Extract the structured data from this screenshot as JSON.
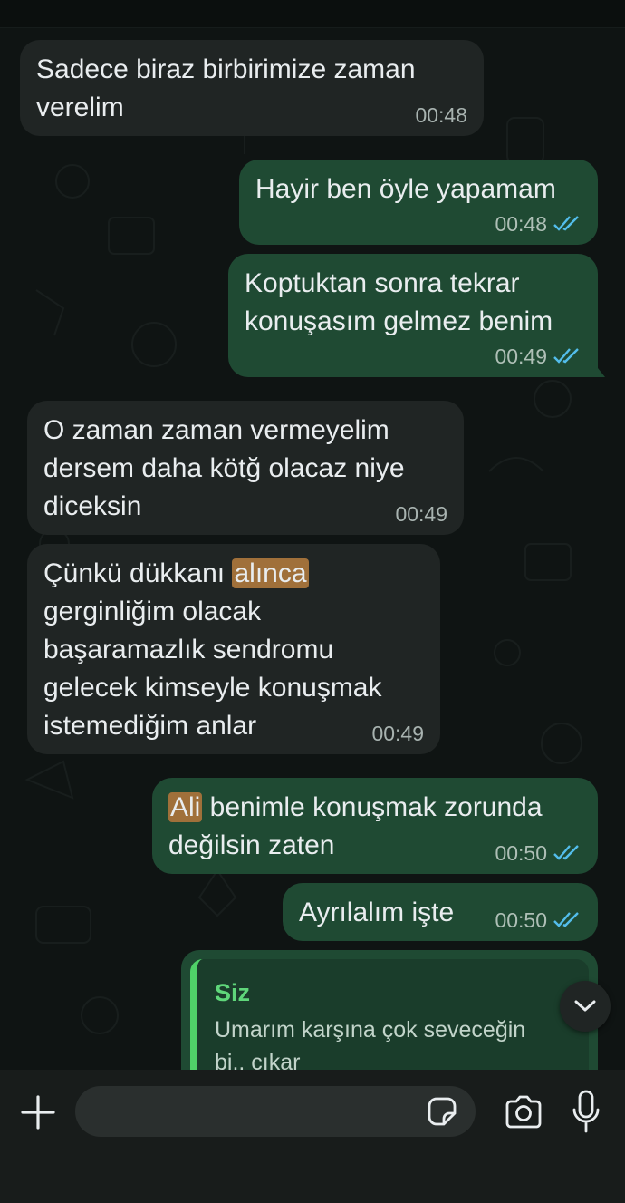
{
  "messages": [
    {
      "dir": "in",
      "text": "Sadece biraz birbirimize zaman\nverelim",
      "time": "00:48"
    },
    {
      "dir": "out",
      "text": "Hayir ben öyle yapamam",
      "time": "00:48",
      "read": true
    },
    {
      "dir": "out",
      "text": "Koptuktan sonra tekrar\nkonuşasım gelmez benim",
      "time": "00:49",
      "read": true
    },
    {
      "dir": "in",
      "text": "O zaman zaman vermeyelim\ndersem daha kötğ olacaz niye\ndiceksin",
      "time": "00:49"
    },
    {
      "dir": "in",
      "pre": "Çünkü dükkanı ",
      "highlight": "alınca",
      "post": "\ngerginliğim  olacak\nbaşaramazlık sendromu\ngelecek kimseyle konuşmak\nistemediğim anlar",
      "time": "00:49"
    },
    {
      "dir": "out",
      "highlight": "Ali",
      "post": " benimle konuşmak zorunda\ndeğilsin zaten",
      "time": "00:50",
      "read": true
    },
    {
      "dir": "out",
      "text": "Ayrılalım işte",
      "time": "00:50",
      "read": true
    }
  ],
  "reply_quote": {
    "author": "Siz",
    "text": "Umarım karşına çok seveceğin bi.. çıkar"
  },
  "composer": {
    "placeholder": ""
  },
  "icons": {
    "plus": "plus-icon",
    "sticker": "sticker-icon",
    "camera": "camera-icon",
    "mic": "microphone-icon",
    "scroll": "chevron-down-icon",
    "read_receipt": "double-check-icon"
  },
  "colors": {
    "incoming": "#202524",
    "outgoing": "#1f4a33",
    "read_tick": "#53bdeb",
    "highlight": "#a0703a",
    "quote_bar": "#4fd168"
  }
}
